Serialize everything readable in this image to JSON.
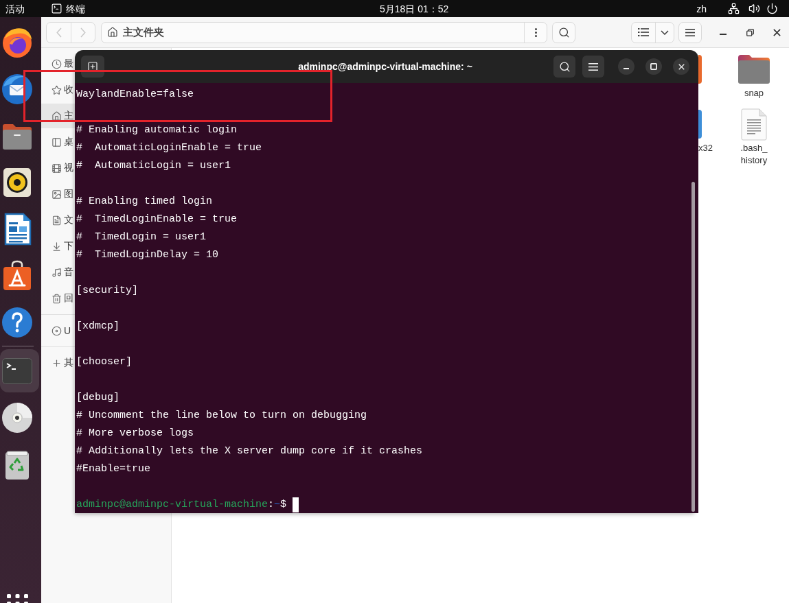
{
  "top_bar": {
    "activities": "活动",
    "app_menu": "终端",
    "clock": "5月18日 01：52",
    "input_method": "zh"
  },
  "dock": {
    "pinned": [
      {
        "kind": "browser",
        "selected": false
      },
      {
        "kind": "mail",
        "selected": false
      },
      {
        "kind": "files",
        "selected": false
      },
      {
        "kind": "music",
        "selected": false
      },
      {
        "kind": "writer",
        "selected": false
      },
      {
        "kind": "store",
        "selected": false
      },
      {
        "kind": "help",
        "selected": false
      }
    ],
    "others": [
      {
        "kind": "terminal",
        "selected": true
      },
      {
        "kind": "disc",
        "selected": false
      },
      {
        "kind": "trash",
        "selected": false
      }
    ]
  },
  "file_manager": {
    "navigation": {
      "back": {
        "disabled": true
      },
      "forward": {
        "disabled": true
      }
    },
    "location": "主文件夹",
    "sidebar": {
      "places": [
        {
          "label": "最",
          "selected": false
        },
        {
          "label": "收",
          "selected": false
        },
        {
          "label": "主",
          "selected": true
        },
        {
          "label": "桌",
          "selected": false
        },
        {
          "label": "视",
          "selected": false
        },
        {
          "label": "图",
          "selected": false
        },
        {
          "label": "文",
          "selected": false
        },
        {
          "label": "下",
          "selected": false
        },
        {
          "label": "音",
          "selected": false
        },
        {
          "label": "回",
          "selected": false
        }
      ],
      "devices": [
        {
          "label": "U",
          "selected": false
        }
      ],
      "other": [
        {
          "label": "其",
          "selected": false
        }
      ]
    },
    "files": [
      {
        "kind": "tile",
        "color": "#e8692c"
      },
      {
        "kind": "folder",
        "label": "snap"
      },
      {
        "kind": "tile",
        "color": "#3d8ed8",
        "label": "x32"
      },
      {
        "kind": "text_file",
        "label": ".bash_history"
      }
    ]
  },
  "terminal": {
    "title": "adminpc@adminpc-virtual-machine: ~",
    "blocks": [
      [
        "WaylandEnable=false"
      ],
      [
        "# Enabling automatic login",
        "#  AutomaticLoginEnable = true",
        "#  AutomaticLogin = user1"
      ],
      [
        "# Enabling timed login",
        "#  TimedLoginEnable = true",
        "#  TimedLogin = user1",
        "#  TimedLoginDelay = 10"
      ],
      [
        "[security]"
      ],
      [
        "[xdmcp]"
      ],
      [
        "[chooser]"
      ],
      [
        "[debug]",
        "# Uncomment the line below to turn on debugging",
        "# More verbose logs",
        "# Additionally lets the X server dump core if it crashes",
        "#Enable=true"
      ]
    ],
    "prompt": {
      "user_host": "adminpc@adminpc-virtual-machine",
      "separator": ":",
      "path": "~",
      "symbol": "$"
    }
  },
  "annotation": {
    "kind": "rectangle"
  }
}
